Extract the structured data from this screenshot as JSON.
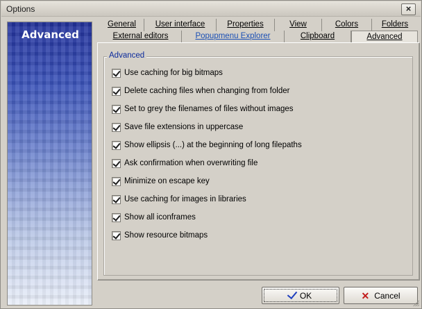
{
  "window": {
    "title": "Options",
    "close_label": "×"
  },
  "banner": {
    "title": "Advanced"
  },
  "tabs_row1": [
    "General",
    "User interface",
    "Properties",
    "View",
    "Colors",
    "Folders"
  ],
  "tabs_row2": [
    "External editors",
    "Popupmenu Explorer",
    "Clipboard",
    "Advanced"
  ],
  "active_tab": "Advanced",
  "group": {
    "label": "Advanced",
    "options": [
      {
        "label": "Use caching for big bitmaps",
        "checked": true
      },
      {
        "label": "Delete caching files when changing from folder",
        "checked": true
      },
      {
        "label": "Set to grey the filenames of files without images",
        "checked": true
      },
      {
        "label": "Save file extensions in uppercase",
        "checked": true
      },
      {
        "label": "Show ellipsis (...) at the beginning of long filepaths",
        "checked": true
      },
      {
        "label": "Ask confirmation when overwriting file",
        "checked": true
      },
      {
        "label": "Minimize on escape key",
        "checked": true
      },
      {
        "label": "Use caching for images in libraries",
        "checked": true
      },
      {
        "label": "Show all iconframes",
        "checked": true
      },
      {
        "label": "Show resource bitmaps",
        "checked": true
      }
    ]
  },
  "buttons": {
    "ok_label": "OK",
    "cancel_label": "Cancel"
  },
  "colors": {
    "group_label": "#0b2a9c",
    "highlight_tab": "#1a4fb5",
    "banner_top": "#22319a"
  },
  "icons": {
    "ok": "checkmark-icon",
    "cancel": "x-icon",
    "close": "close-icon"
  }
}
